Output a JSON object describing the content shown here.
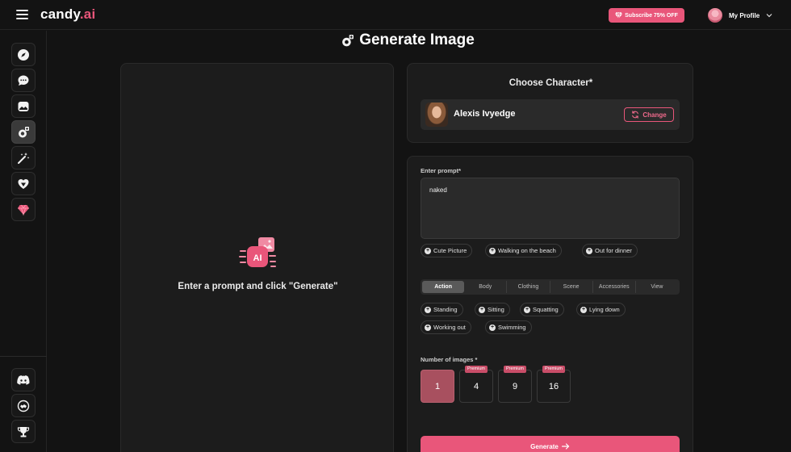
{
  "header": {
    "logo_main": "candy",
    "logo_tld": ".ai",
    "subscribe_label": "Subscribe 75% OFF",
    "profile_label": "My Profile"
  },
  "sidebar": {
    "items": [
      {
        "name": "explore",
        "icon": "compass-icon"
      },
      {
        "name": "chat",
        "icon": "chat-bubble-icon"
      },
      {
        "name": "gallery",
        "icon": "image-icon"
      },
      {
        "name": "generate-image",
        "icon": "camera-plus-icon",
        "active": true
      },
      {
        "name": "create-character",
        "icon": "magic-wand-icon"
      },
      {
        "name": "my-ai",
        "icon": "heart-shield-icon"
      },
      {
        "name": "premium",
        "icon": "gem-icon"
      }
    ],
    "bottom_items": [
      {
        "name": "discord",
        "icon": "discord-icon"
      },
      {
        "name": "affiliate",
        "icon": "handshake-icon"
      },
      {
        "name": "leaderboard",
        "icon": "trophy-icon"
      }
    ]
  },
  "page": {
    "title": "Generate Image"
  },
  "preview": {
    "placeholder_text": "Enter a prompt and click \"Generate\""
  },
  "character": {
    "section_title": "Choose Character*",
    "name": "Alexis Ivyedge",
    "change_label": "Change"
  },
  "form": {
    "prompt_label": "Enter prompt*",
    "prompt_value": "naked",
    "suggestions": [
      "Cute Picture",
      "Walking on the beach",
      "Out for dinner"
    ],
    "tabs": [
      {
        "label": "Action",
        "active": true
      },
      {
        "label": "Body"
      },
      {
        "label": "Clothing"
      },
      {
        "label": "Scene"
      },
      {
        "label": "Accessories"
      },
      {
        "label": "View"
      }
    ],
    "action_chips": [
      "Standing",
      "Sitting",
      "Squatting",
      "Lying down",
      "Working out",
      "Swimming"
    ],
    "count_label": "Number of images *",
    "counts": [
      {
        "value": "1",
        "selected": true,
        "badge": ""
      },
      {
        "value": "4",
        "badge": "Premium"
      },
      {
        "value": "9",
        "badge": "Premium"
      },
      {
        "value": "16",
        "badge": "Premium"
      }
    ],
    "generate_label": "Generate"
  },
  "colors": {
    "accent": "#e9567a",
    "background": "#131313",
    "panel": "#1c1c1c",
    "selected_count": "#a8505f"
  }
}
